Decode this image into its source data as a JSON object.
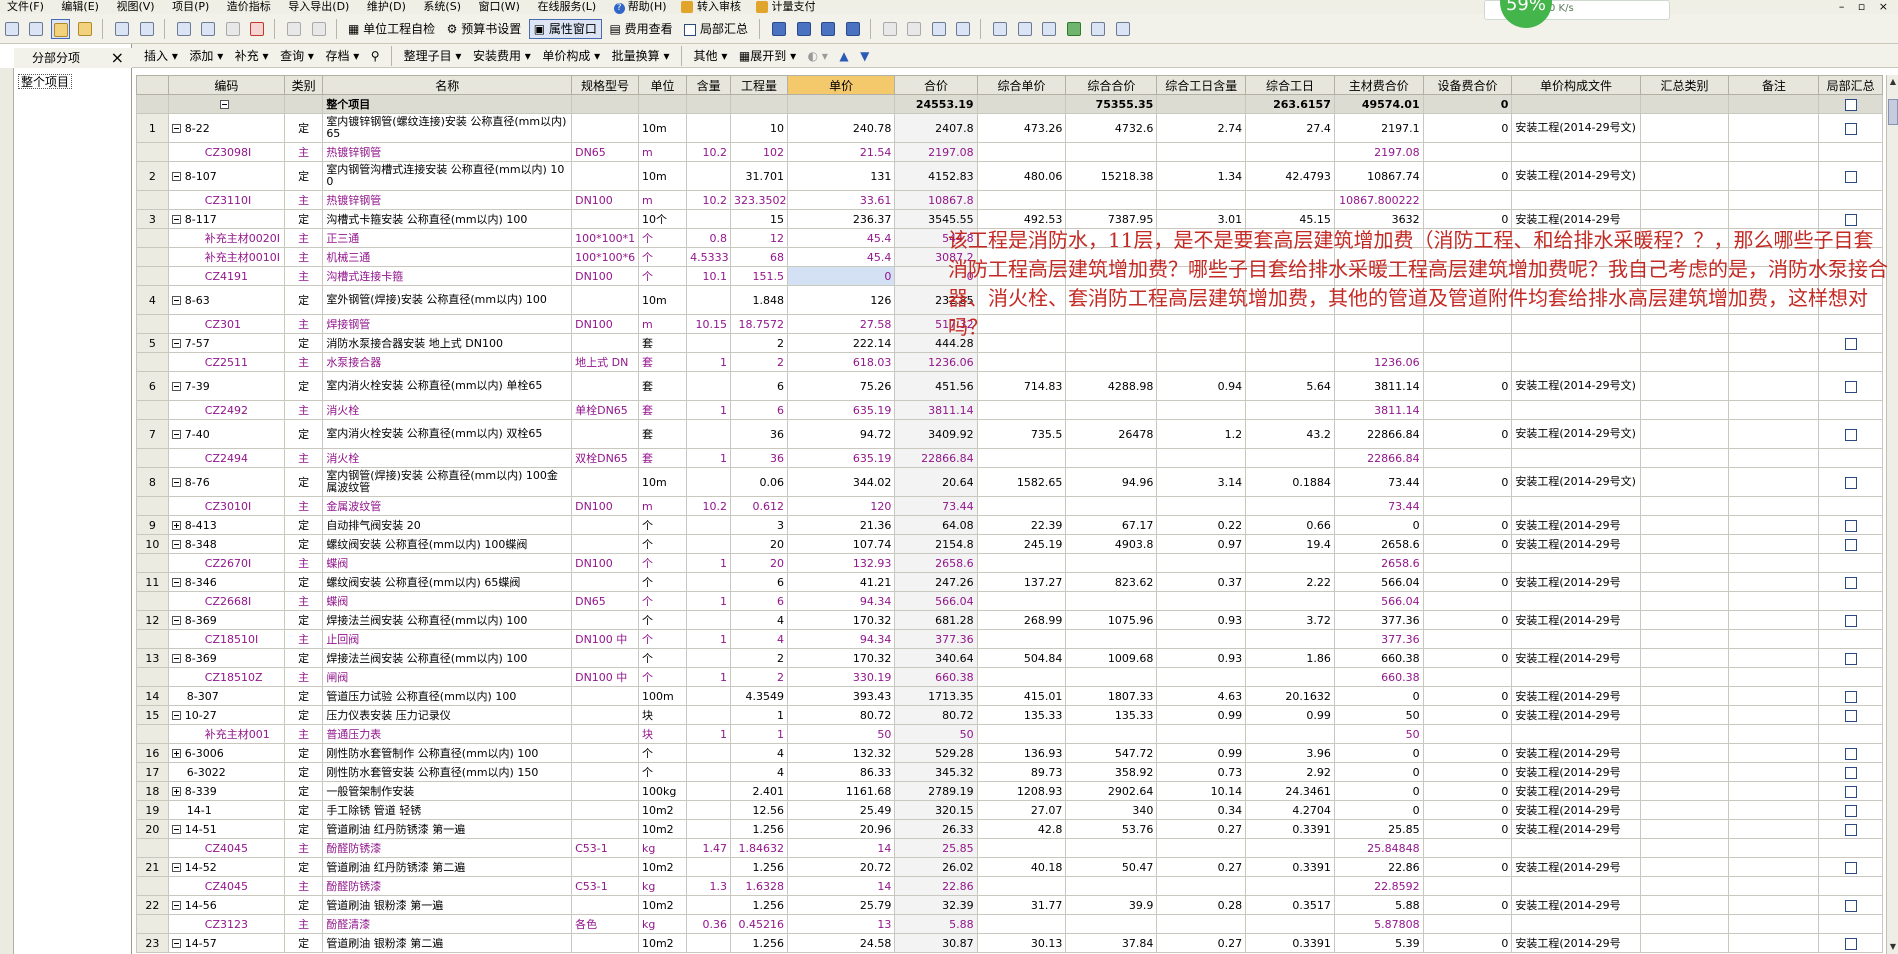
{
  "menu": [
    "文件(F)",
    "编辑(E)",
    "视图(V)",
    "项目(P)",
    "造价指标",
    "导入导出(D)",
    "维护(D)",
    "系统(S)",
    "窗口(W)",
    "在线服务(L)"
  ],
  "menu_help": "帮助(H)",
  "menu_right": [
    "转入审核",
    "计量支付"
  ],
  "window_controls": [
    "–",
    "▫",
    "×"
  ],
  "perf": {
    "percent": "59%",
    "speed": "0 K/s",
    "color": "#43b54a"
  },
  "toolbar1": {
    "unit_check": "单位工程自检",
    "budget_settings": "预算书设置",
    "property_window": "属性窗口",
    "fee_view": "费用查看",
    "local_summary": "局部汇总"
  },
  "left_panel": {
    "title": "分部分项",
    "close": "×",
    "tree_item": "整个项目"
  },
  "toolbar2": [
    "插入",
    "添加",
    "补充",
    "查询",
    "存档",
    "整理子目",
    "安装费用",
    "单价构成",
    "批量换算",
    "其他",
    "展开到"
  ],
  "columns": [
    "",
    "编码",
    "类别",
    "名称",
    "规格型号",
    "单位",
    "含量",
    "工程量",
    "单价",
    "合价",
    "综合单价",
    "综合合价",
    "综合工日含量",
    "综合工日",
    "主材费合价",
    "设备费合价",
    "单价构成文件",
    "汇总类别",
    "备注",
    "局部汇总"
  ],
  "total_row": {
    "name": "整个项目",
    "amount": "24553.19",
    "comp_total": "75355.35",
    "labor": "263.6157",
    "main_mat": "49574.01",
    "equip": "0"
  },
  "rows": [
    {
      "t": "d2",
      "n": "1",
      "e": "-",
      "c": "8-22",
      "k": "定",
      "name": "室内镀锌钢管(螺纹连接)安装 公称直径(mm以内) 65",
      "spec": "",
      "u": "10m",
      "h": "",
      "q": "10",
      "p": "240.78",
      "a": "2407.8",
      "cu": "473.26",
      "ca": "4732.6",
      "lh": "2.74",
      "l": "27.4",
      "mm": "2197.1",
      "eq": "0",
      "f": "安装工程(2014-29号文)",
      "chk": true
    },
    {
      "t": "m",
      "n": "",
      "e": "",
      "c": "CZ3098I",
      "k": "主",
      "name": "热镀锌钢管",
      "spec": "DN65",
      "u": "m",
      "h": "10.2",
      "q": "102",
      "p": "21.54",
      "a": "2197.08",
      "cu": "",
      "ca": "",
      "lh": "",
      "l": "",
      "mm": "2197.08",
      "eq": "",
      "f": "",
      "chk": false
    },
    {
      "t": "d2",
      "n": "2",
      "e": "-",
      "c": "8-107",
      "k": "定",
      "name": "室内钢管沟槽式连接安装 公称直径(mm以内) 100",
      "spec": "",
      "u": "10m",
      "h": "",
      "q": "31.701",
      "p": "131",
      "a": "4152.83",
      "cu": "480.06",
      "ca": "15218.38",
      "lh": "1.34",
      "l": "42.4793",
      "mm": "10867.74",
      "eq": "0",
      "f": "安装工程(2014-29号文)",
      "chk": true
    },
    {
      "t": "m",
      "n": "",
      "e": "",
      "c": "CZ3110I",
      "k": "主",
      "name": "热镀锌钢管",
      "spec": "DN100",
      "u": "m",
      "h": "10.2",
      "q": "323.3502",
      "p": "33.61",
      "a": "10867.8",
      "cu": "",
      "ca": "",
      "lh": "",
      "l": "",
      "mm": "10867.800222",
      "eq": "",
      "f": "",
      "chk": false
    },
    {
      "t": "d1",
      "n": "3",
      "e": "-",
      "c": "8-117",
      "k": "定",
      "name": "沟槽式卡箍安装 公称直径(mm以内) 100",
      "spec": "",
      "u": "10个",
      "h": "",
      "q": "15",
      "p": "236.37",
      "a": "3545.55",
      "cu": "492.53",
      "ca": "7387.95",
      "lh": "3.01",
      "l": "45.15",
      "mm": "3632",
      "eq": "0",
      "f": "安装工程(2014-29号",
      "chk": true
    },
    {
      "t": "m",
      "n": "",
      "e": "",
      "c": "补充主材0020I",
      "k": "主",
      "name": "正三通",
      "spec": "100*100*1",
      "u": "个",
      "h": "0.8",
      "q": "12",
      "p": "45.4",
      "a": "544.8",
      "cu": "",
      "ca": "",
      "lh": "",
      "l": "",
      "mm": "",
      "eq": "",
      "f": "",
      "chk": false
    },
    {
      "t": "m",
      "n": "",
      "e": "",
      "c": "补充主材0010I",
      "k": "主",
      "name": "机械三通",
      "spec": "100*100*6",
      "u": "个",
      "h": "4.5333",
      "q": "68",
      "p": "45.4",
      "a": "3087.2",
      "cu": "",
      "ca": "",
      "lh": "",
      "l": "",
      "mm": "",
      "eq": "",
      "f": "",
      "chk": false
    },
    {
      "t": "m",
      "n": "",
      "e": "",
      "c": "CZ4191",
      "k": "主",
      "name": "沟槽式连接卡箍",
      "spec": "DN100",
      "u": "个",
      "h": "10.1",
      "q": "151.5",
      "p": "0",
      "a": "0",
      "cu": "",
      "ca": "",
      "lh": "",
      "l": "",
      "mm": "",
      "eq": "",
      "f": "",
      "chk": false,
      "sel": true
    },
    {
      "t": "d2",
      "n": "4",
      "e": "-",
      "c": "8-63",
      "k": "定",
      "name": "室外钢管(焊接)安装 公称直径(mm以内) 100",
      "spec": "",
      "u": "10m",
      "h": "",
      "q": "1.848",
      "p": "126",
      "a": "232.85",
      "cu": "",
      "ca": "",
      "lh": "",
      "l": "",
      "mm": "",
      "eq": "",
      "f": "",
      "chk": false
    },
    {
      "t": "m",
      "n": "",
      "e": "",
      "c": "CZ301",
      "k": "主",
      "name": "焊接钢管",
      "spec": "DN100",
      "u": "m",
      "h": "10.15",
      "q": "18.7572",
      "p": "27.58",
      "a": "517.32",
      "cu": "",
      "ca": "",
      "lh": "",
      "l": "",
      "mm": "",
      "eq": "",
      "f": "",
      "chk": false
    },
    {
      "t": "d1",
      "n": "5",
      "e": "-",
      "c": "7-57",
      "k": "定",
      "name": "消防水泵接合器安装 地上式 DN100",
      "spec": "",
      "u": "套",
      "h": "",
      "q": "2",
      "p": "222.14",
      "a": "444.28",
      "cu": "",
      "ca": "",
      "lh": "",
      "l": "",
      "mm": "",
      "eq": "",
      "f": "",
      "chk": true
    },
    {
      "t": "m",
      "n": "",
      "e": "",
      "c": "CZ2511",
      "k": "主",
      "name": "水泵接合器",
      "spec": "地上式 DN",
      "u": "套",
      "h": "1",
      "q": "2",
      "p": "618.03",
      "a": "1236.06",
      "cu": "",
      "ca": "",
      "lh": "",
      "l": "",
      "mm": "1236.06",
      "eq": "",
      "f": "",
      "chk": false
    },
    {
      "t": "d2",
      "n": "6",
      "e": "-",
      "c": "7-39",
      "k": "定",
      "name": "室内消火栓安装 公称直径(mm以内) 单栓65",
      "spec": "",
      "u": "套",
      "h": "",
      "q": "6",
      "p": "75.26",
      "a": "451.56",
      "cu": "714.83",
      "ca": "4288.98",
      "lh": "0.94",
      "l": "5.64",
      "mm": "3811.14",
      "eq": "0",
      "f": "安装工程(2014-29号文)",
      "chk": true
    },
    {
      "t": "m",
      "n": "",
      "e": "",
      "c": "CZ2492",
      "k": "主",
      "name": "消火栓",
      "spec": "单栓DN65",
      "u": "套",
      "h": "1",
      "q": "6",
      "p": "635.19",
      "a": "3811.14",
      "cu": "",
      "ca": "",
      "lh": "",
      "l": "",
      "mm": "3811.14",
      "eq": "",
      "f": "",
      "chk": false
    },
    {
      "t": "d2",
      "n": "7",
      "e": "-",
      "c": "7-40",
      "k": "定",
      "name": "室内消火栓安装 公称直径(mm以内) 双栓65",
      "spec": "",
      "u": "套",
      "h": "",
      "q": "36",
      "p": "94.72",
      "a": "3409.92",
      "cu": "735.5",
      "ca": "26478",
      "lh": "1.2",
      "l": "43.2",
      "mm": "22866.84",
      "eq": "0",
      "f": "安装工程(2014-29号文)",
      "chk": true
    },
    {
      "t": "m",
      "n": "",
      "e": "",
      "c": "CZ2494",
      "k": "主",
      "name": "消火栓",
      "spec": "双栓DN65",
      "u": "套",
      "h": "1",
      "q": "36",
      "p": "635.19",
      "a": "22866.84",
      "cu": "",
      "ca": "",
      "lh": "",
      "l": "",
      "mm": "22866.84",
      "eq": "",
      "f": "",
      "chk": false
    },
    {
      "t": "d2",
      "n": "8",
      "e": "-",
      "c": "8-76",
      "k": "定",
      "name": "室内钢管(焊接)安装 公称直径(mm以内) 100金属波纹管",
      "spec": "",
      "u": "10m",
      "h": "",
      "q": "0.06",
      "p": "344.02",
      "a": "20.64",
      "cu": "1582.65",
      "ca": "94.96",
      "lh": "3.14",
      "l": "0.1884",
      "mm": "73.44",
      "eq": "0",
      "f": "安装工程(2014-29号文)",
      "chk": true
    },
    {
      "t": "m",
      "n": "",
      "e": "",
      "c": "CZ3010I",
      "k": "主",
      "name": "金属波纹管",
      "spec": "DN100",
      "u": "m",
      "h": "10.2",
      "q": "0.612",
      "p": "120",
      "a": "73.44",
      "cu": "",
      "ca": "",
      "lh": "",
      "l": "",
      "mm": "73.44",
      "eq": "",
      "f": "",
      "chk": false
    },
    {
      "t": "d1",
      "n": "9",
      "e": "+",
      "c": "8-413",
      "k": "定",
      "name": "自动排气阀安装 20",
      "spec": "",
      "u": "个",
      "h": "",
      "q": "3",
      "p": "21.36",
      "a": "64.08",
      "cu": "22.39",
      "ca": "67.17",
      "lh": "0.22",
      "l": "0.66",
      "mm": "0",
      "eq": "0",
      "f": "安装工程(2014-29号",
      "chk": true
    },
    {
      "t": "d1",
      "n": "10",
      "e": "-",
      "c": "8-348",
      "k": "定",
      "name": "螺纹阀安装 公称直径(mm以内) 100蝶阀",
      "spec": "",
      "u": "个",
      "h": "",
      "q": "20",
      "p": "107.74",
      "a": "2154.8",
      "cu": "245.19",
      "ca": "4903.8",
      "lh": "0.97",
      "l": "19.4",
      "mm": "2658.6",
      "eq": "0",
      "f": "安装工程(2014-29号",
      "chk": true
    },
    {
      "t": "m",
      "n": "",
      "e": "",
      "c": "CZ2670I",
      "k": "主",
      "name": "蝶阀",
      "spec": "DN100",
      "u": "个",
      "h": "1",
      "q": "20",
      "p": "132.93",
      "a": "2658.6",
      "cu": "",
      "ca": "",
      "lh": "",
      "l": "",
      "mm": "2658.6",
      "eq": "",
      "f": "",
      "chk": false
    },
    {
      "t": "d1",
      "n": "11",
      "e": "-",
      "c": "8-346",
      "k": "定",
      "name": "螺纹阀安装 公称直径(mm以内) 65蝶阀",
      "spec": "",
      "u": "个",
      "h": "",
      "q": "6",
      "p": "41.21",
      "a": "247.26",
      "cu": "137.27",
      "ca": "823.62",
      "lh": "0.37",
      "l": "2.22",
      "mm": "566.04",
      "eq": "0",
      "f": "安装工程(2014-29号",
      "chk": true
    },
    {
      "t": "m",
      "n": "",
      "e": "",
      "c": "CZ2668I",
      "k": "主",
      "name": "蝶阀",
      "spec": "DN65",
      "u": "个",
      "h": "1",
      "q": "6",
      "p": "94.34",
      "a": "566.04",
      "cu": "",
      "ca": "",
      "lh": "",
      "l": "",
      "mm": "566.04",
      "eq": "",
      "f": "",
      "chk": false
    },
    {
      "t": "d1",
      "n": "12",
      "e": "-",
      "c": "8-369",
      "k": "定",
      "name": "焊接法兰阀安装 公称直径(mm以内) 100",
      "spec": "",
      "u": "个",
      "h": "",
      "q": "4",
      "p": "170.32",
      "a": "681.28",
      "cu": "268.99",
      "ca": "1075.96",
      "lh": "0.93",
      "l": "3.72",
      "mm": "377.36",
      "eq": "0",
      "f": "安装工程(2014-29号",
      "chk": true
    },
    {
      "t": "m",
      "n": "",
      "e": "",
      "c": "CZ18510I",
      "k": "主",
      "name": "止回阀",
      "spec": "DN100 中",
      "u": "个",
      "h": "1",
      "q": "4",
      "p": "94.34",
      "a": "377.36",
      "cu": "",
      "ca": "",
      "lh": "",
      "l": "",
      "mm": "377.36",
      "eq": "",
      "f": "",
      "chk": false
    },
    {
      "t": "d1",
      "n": "13",
      "e": "-",
      "c": "8-369",
      "k": "定",
      "name": "焊接法兰阀安装 公称直径(mm以内) 100",
      "spec": "",
      "u": "个",
      "h": "",
      "q": "2",
      "p": "170.32",
      "a": "340.64",
      "cu": "504.84",
      "ca": "1009.68",
      "lh": "0.93",
      "l": "1.86",
      "mm": "660.38",
      "eq": "0",
      "f": "安装工程(2014-29号",
      "chk": true
    },
    {
      "t": "m",
      "n": "",
      "e": "",
      "c": "CZ18510Z",
      "k": "主",
      "name": "闸阀",
      "spec": "DN100 中",
      "u": "个",
      "h": "1",
      "q": "2",
      "p": "330.19",
      "a": "660.38",
      "cu": "",
      "ca": "",
      "lh": "",
      "l": "",
      "mm": "660.38",
      "eq": "",
      "f": "",
      "chk": false
    },
    {
      "t": "d1",
      "n": "14",
      "e": "",
      "c": "8-307",
      "k": "定",
      "name": "管道压力试验 公称直径(mm以内) 100",
      "spec": "",
      "u": "100m",
      "h": "",
      "q": "4.3549",
      "p": "393.43",
      "a": "1713.35",
      "cu": "415.01",
      "ca": "1807.33",
      "lh": "4.63",
      "l": "20.1632",
      "mm": "0",
      "eq": "0",
      "f": "安装工程(2014-29号",
      "chk": true
    },
    {
      "t": "d1",
      "n": "15",
      "e": "-",
      "c": "10-27",
      "k": "定",
      "name": "压力仪表安装 压力记录仪",
      "spec": "",
      "u": "块",
      "h": "",
      "q": "1",
      "p": "80.72",
      "a": "80.72",
      "cu": "135.33",
      "ca": "135.33",
      "lh": "0.99",
      "l": "0.99",
      "mm": "50",
      "eq": "0",
      "f": "安装工程(2014-29号",
      "chk": true
    },
    {
      "t": "m",
      "n": "",
      "e": "",
      "c": "补充主材001",
      "k": "主",
      "name": "普通压力表",
      "spec": "",
      "u": "块",
      "h": "1",
      "q": "1",
      "p": "50",
      "a": "50",
      "cu": "",
      "ca": "",
      "lh": "",
      "l": "",
      "mm": "50",
      "eq": "",
      "f": "",
      "chk": false
    },
    {
      "t": "d1",
      "n": "16",
      "e": "+",
      "c": "6-3006",
      "k": "定",
      "name": "刚性防水套管制作 公称直径(mm以内) 100",
      "spec": "",
      "u": "个",
      "h": "",
      "q": "4",
      "p": "132.32",
      "a": "529.28",
      "cu": "136.93",
      "ca": "547.72",
      "lh": "0.99",
      "l": "3.96",
      "mm": "0",
      "eq": "0",
      "f": "安装工程(2014-29号",
      "chk": true
    },
    {
      "t": "d1",
      "n": "17",
      "e": "",
      "c": "6-3022",
      "k": "定",
      "name": "刚性防水套管安装 公称直径(mm以内) 150",
      "spec": "",
      "u": "个",
      "h": "",
      "q": "4",
      "p": "86.33",
      "a": "345.32",
      "cu": "89.73",
      "ca": "358.92",
      "lh": "0.73",
      "l": "2.92",
      "mm": "0",
      "eq": "0",
      "f": "安装工程(2014-29号",
      "chk": true
    },
    {
      "t": "d1",
      "n": "18",
      "e": "+",
      "c": "8-339",
      "k": "定",
      "name": "一般管架制作安装",
      "spec": "",
      "u": "100kg",
      "h": "",
      "q": "2.401",
      "p": "1161.68",
      "a": "2789.19",
      "cu": "1208.93",
      "ca": "2902.64",
      "lh": "10.14",
      "l": "24.3461",
      "mm": "0",
      "eq": "0",
      "f": "安装工程(2014-29号",
      "chk": true
    },
    {
      "t": "d1",
      "n": "19",
      "e": "",
      "c": "14-1",
      "k": "定",
      "name": "手工除锈 管道 轻锈",
      "spec": "",
      "u": "10m2",
      "h": "",
      "q": "12.56",
      "p": "25.49",
      "a": "320.15",
      "cu": "27.07",
      "ca": "340",
      "lh": "0.34",
      "l": "4.2704",
      "mm": "0",
      "eq": "0",
      "f": "安装工程(2014-29号",
      "chk": true
    },
    {
      "t": "d1",
      "n": "20",
      "e": "-",
      "c": "14-51",
      "k": "定",
      "name": "管道刷油 红丹防锈漆 第一遍",
      "spec": "",
      "u": "10m2",
      "h": "",
      "q": "1.256",
      "p": "20.96",
      "a": "26.33",
      "cu": "42.8",
      "ca": "53.76",
      "lh": "0.27",
      "l": "0.3391",
      "mm": "25.85",
      "eq": "0",
      "f": "安装工程(2014-29号",
      "chk": true
    },
    {
      "t": "m",
      "n": "",
      "e": "",
      "c": "CZ4045",
      "k": "主",
      "name": "酚醛防锈漆",
      "spec": "C53-1",
      "u": "kg",
      "h": "1.47",
      "q": "1.84632",
      "p": "14",
      "a": "25.85",
      "cu": "",
      "ca": "",
      "lh": "",
      "l": "",
      "mm": "25.84848",
      "eq": "",
      "f": "",
      "chk": false
    },
    {
      "t": "d1",
      "n": "21",
      "e": "-",
      "c": "14-52",
      "k": "定",
      "name": "管道刷油 红丹防锈漆 第二遍",
      "spec": "",
      "u": "10m2",
      "h": "",
      "q": "1.256",
      "p": "20.72",
      "a": "26.02",
      "cu": "40.18",
      "ca": "50.47",
      "lh": "0.27",
      "l": "0.3391",
      "mm": "22.86",
      "eq": "0",
      "f": "安装工程(2014-29号",
      "chk": true
    },
    {
      "t": "m",
      "n": "",
      "e": "",
      "c": "CZ4045",
      "k": "主",
      "name": "酚醛防锈漆",
      "spec": "C53-1",
      "u": "kg",
      "h": "1.3",
      "q": "1.6328",
      "p": "14",
      "a": "22.86",
      "cu": "",
      "ca": "",
      "lh": "",
      "l": "",
      "mm": "22.8592",
      "eq": "",
      "f": "",
      "chk": false
    },
    {
      "t": "d1",
      "n": "22",
      "e": "-",
      "c": "14-56",
      "k": "定",
      "name": "管道刷油 银粉漆 第一遍",
      "spec": "",
      "u": "10m2",
      "h": "",
      "q": "1.256",
      "p": "25.79",
      "a": "32.39",
      "cu": "31.77",
      "ca": "39.9",
      "lh": "0.28",
      "l": "0.3517",
      "mm": "5.88",
      "eq": "0",
      "f": "安装工程(2014-29号",
      "chk": true
    },
    {
      "t": "m",
      "n": "",
      "e": "",
      "c": "CZ3123",
      "k": "主",
      "name": "酚醛清漆",
      "spec": "各色",
      "u": "kg",
      "h": "0.36",
      "q": "0.45216",
      "p": "13",
      "a": "5.88",
      "cu": "",
      "ca": "",
      "lh": "",
      "l": "",
      "mm": "5.87808",
      "eq": "",
      "f": "",
      "chk": false
    },
    {
      "t": "d1",
      "n": "23",
      "e": "-",
      "c": "14-57",
      "k": "定",
      "name": "管道刷油 银粉漆 第二遍",
      "spec": "",
      "u": "10m2",
      "h": "",
      "q": "1.256",
      "p": "24.58",
      "a": "30.87",
      "cu": "30.13",
      "ca": "37.84",
      "lh": "0.27",
      "l": "0.3391",
      "mm": "5.39",
      "eq": "0",
      "f": "安装工程(2014-29号",
      "chk": true
    }
  ],
  "annotation": "该工程是消防水，11层，是不是要套高层建筑增加费（消防工程、和给排水采暖程？？，那么哪些子目套消防工程高层建筑增加费？哪些子目套给排水采暖工程高层建筑增加费呢？我自己考虑的是，消防水泵接合器、消火栓、套消防工程高层建筑增加费，其他的管道及管道附件均套给排水高层建筑增加费，这样想对吗？",
  "colors": {
    "main_material": "#92168c",
    "annotation": "#c42a24",
    "unit_price_header": "#f3c96c"
  }
}
